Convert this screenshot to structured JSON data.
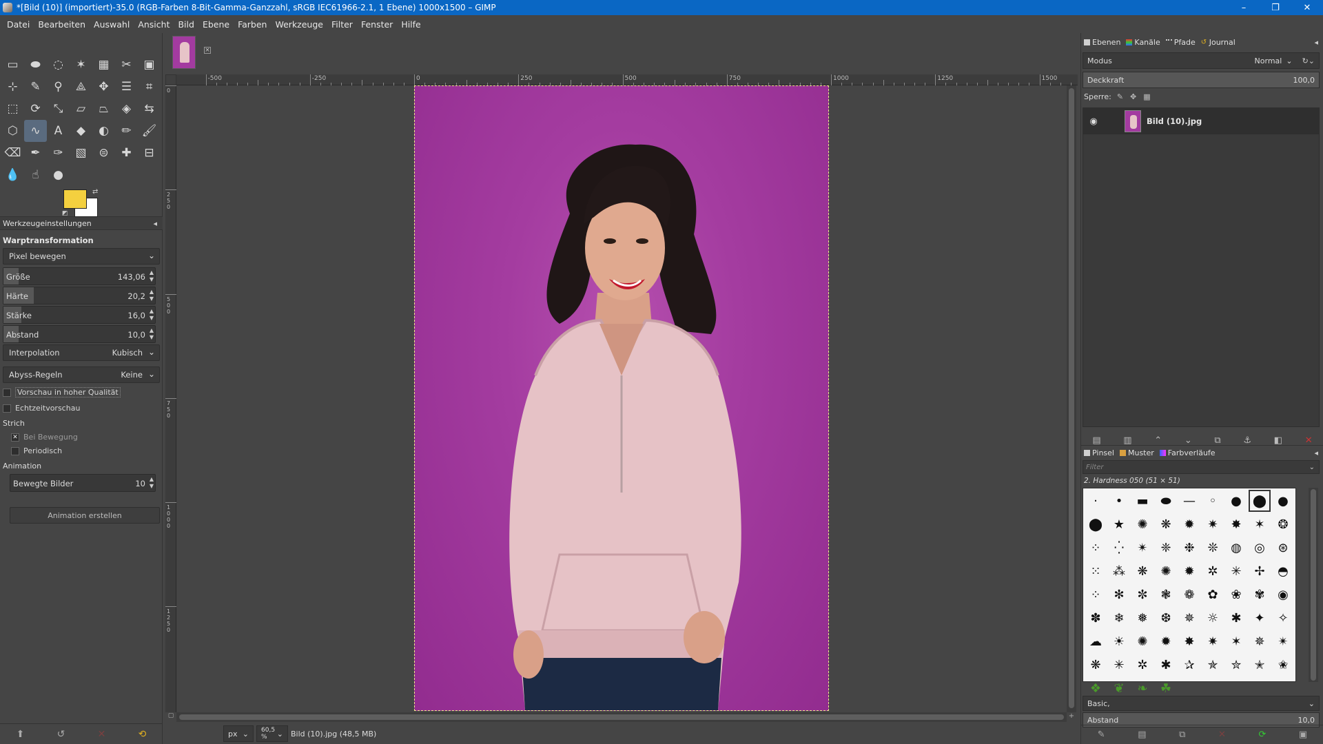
{
  "window": {
    "title": "*[Bild (10)] (importiert)-35.0 (RGB-Farben 8-Bit-Gamma-Ganzzahl, sRGB IEC61966-2.1, 1 Ebene) 1000x1500 – GIMP",
    "minimize": "–",
    "maximize": "❐",
    "close": "✕"
  },
  "menu": [
    "Datei",
    "Bearbeiten",
    "Auswahl",
    "Ansicht",
    "Bild",
    "Ebene",
    "Farben",
    "Werkzeuge",
    "Filter",
    "Fenster",
    "Hilfe"
  ],
  "toolbox": {
    "tools": [
      {
        "icon": "rect-select-icon",
        "glyph": "▭"
      },
      {
        "icon": "ellipse-select-icon",
        "glyph": "⬬"
      },
      {
        "icon": "free-select-icon",
        "glyph": "◌"
      },
      {
        "icon": "fuzzy-select-icon",
        "glyph": "✶"
      },
      {
        "icon": "select-by-color-icon",
        "glyph": "▦"
      },
      {
        "icon": "scissors-select-icon",
        "glyph": "✂"
      },
      {
        "icon": "foreground-select-icon",
        "glyph": "▣"
      },
      {
        "icon": "crosshair-icon",
        "glyph": "⊹"
      },
      {
        "icon": "color-picker-icon",
        "glyph": "✎"
      },
      {
        "icon": "zoom-icon",
        "glyph": "⚲"
      },
      {
        "icon": "measure-icon",
        "glyph": "⟁"
      },
      {
        "icon": "move-icon",
        "glyph": "✥"
      },
      {
        "icon": "align-icon",
        "glyph": "☰"
      },
      {
        "icon": "crop-icon",
        "glyph": "⌗"
      },
      {
        "icon": "unified-transform-icon",
        "glyph": "⬚"
      },
      {
        "icon": "rotate-icon",
        "glyph": "⟳"
      },
      {
        "icon": "scale-icon",
        "glyph": "⤡"
      },
      {
        "icon": "shear-icon",
        "glyph": "▱"
      },
      {
        "icon": "perspective-icon",
        "glyph": "⏢"
      },
      {
        "icon": "3d-transform-icon",
        "glyph": "◈"
      },
      {
        "icon": "flip-icon",
        "glyph": "⇆"
      },
      {
        "icon": "cage-transform-icon",
        "glyph": "⬡"
      },
      {
        "icon": "warp-transform-icon",
        "glyph": "∿"
      },
      {
        "icon": "text-icon",
        "glyph": "A"
      },
      {
        "icon": "bucket-fill-icon",
        "glyph": "◆"
      },
      {
        "icon": "gradient-icon",
        "glyph": "◐"
      },
      {
        "icon": "pencil-icon",
        "glyph": "✏"
      },
      {
        "icon": "paintbrush-icon",
        "glyph": "🖌"
      },
      {
        "icon": "eraser-icon",
        "glyph": "⌫"
      },
      {
        "icon": "airbrush-icon",
        "glyph": "✒"
      },
      {
        "icon": "ink-icon",
        "glyph": "✑"
      },
      {
        "icon": "mypaint-brush-icon",
        "glyph": "▧"
      },
      {
        "icon": "clone-icon",
        "glyph": "⊜"
      },
      {
        "icon": "heal-icon",
        "glyph": "✚"
      },
      {
        "icon": "perspective-clone-icon",
        "glyph": "⊟"
      },
      {
        "icon": "blur-icon",
        "glyph": "💧"
      },
      {
        "icon": "smudge-icon",
        "glyph": "☝"
      },
      {
        "icon": "dodge-burn-icon",
        "glyph": "●"
      }
    ],
    "active_index": 22,
    "fg_color": "#f4d03f",
    "bg_color": "#ffffff"
  },
  "tool_options": {
    "tab_label": "Werkzeugeinstellungen",
    "tool_name": "Warptransformation",
    "mode": "Pixel bewegen",
    "size": {
      "label": "Größe",
      "value": "143,06",
      "fraction": 0.1
    },
    "hardness": {
      "label": "Härte",
      "value": "20,2",
      "fraction": 0.2
    },
    "strength": {
      "label": "Stärke",
      "value": "16,0",
      "fraction": 0.12
    },
    "spacing": {
      "label": "Abstand",
      "value": "10,0",
      "fraction": 0.1
    },
    "interpolation": {
      "label": "Interpolation",
      "value": "Kubisch"
    },
    "abyss": {
      "label": "Abyss-Regeln",
      "value": "Keine"
    },
    "hq_preview": "Vorschau in hoher Qualität",
    "realtime_preview": "Echtzeitvorschau",
    "stroke_section": "Strich",
    "during_motion": "Bei Bewegung",
    "periodic": "Periodisch",
    "animation_section": "Animation",
    "frames": {
      "label": "Bewegte Bilder",
      "value": "10"
    },
    "create_animation": "Animation erstellen"
  },
  "ruler": {
    "labels": [
      "-500",
      "-250",
      "0",
      "250",
      "500",
      "750",
      "1000",
      "1250",
      "1500"
    ],
    "vlabels": [
      "0",
      "250",
      "500",
      "750",
      "1000",
      "1250"
    ]
  },
  "statusbar": {
    "unit": "px",
    "zoom": "60,5 %",
    "file": "Bild (10).jpg (48,5 MB)"
  },
  "layers_dock": {
    "tabs": [
      "Ebenen",
      "Kanäle",
      "Pfade",
      "Journal"
    ],
    "mode_label": "Modus",
    "mode_value": "Normal",
    "opacity_label": "Deckkraft",
    "opacity_value": "100,0",
    "lock_label": "Sperre:",
    "layer_name": "Bild (10).jpg"
  },
  "brushes_dock": {
    "tabs": [
      "Pinsel",
      "Muster",
      "Farbverläufe"
    ],
    "filter_placeholder": "Filter",
    "brush_name": "2. Hardness 050 (51 × 51)",
    "preset": "Basic,",
    "spacing_label": "Abstand",
    "spacing_value": "10,0"
  }
}
